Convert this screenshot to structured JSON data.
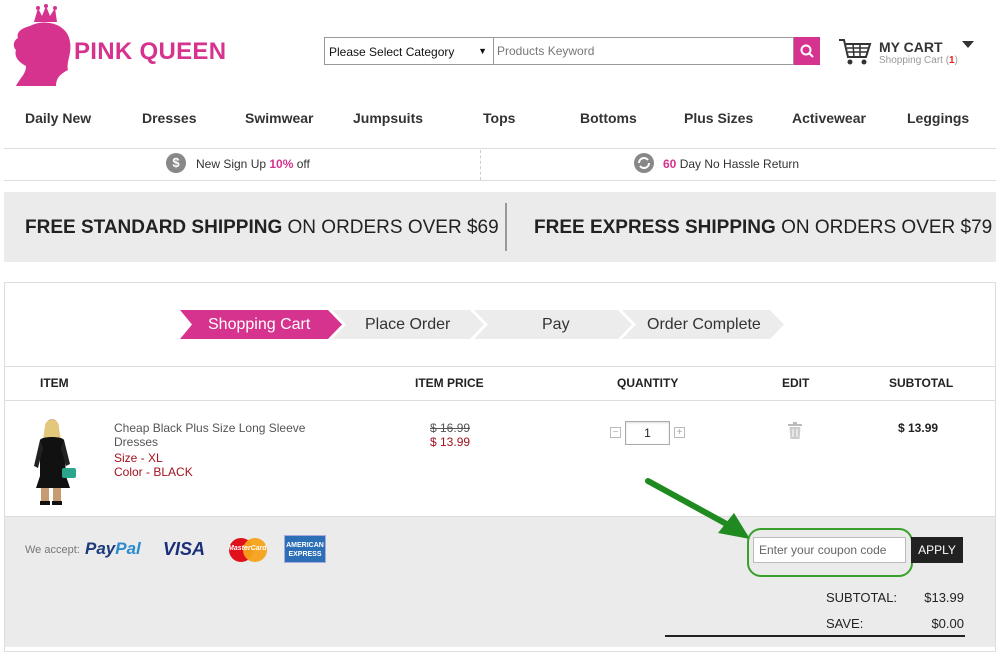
{
  "header": {
    "brand": "PINK QUEEN",
    "category_select": "Please Select Category",
    "search_placeholder": "Products Keyword",
    "cart_title": "MY CART",
    "cart_sub_prefix": "Shopping Cart (",
    "cart_count": "1",
    "cart_sub_suffix": ")"
  },
  "nav": [
    "Daily New",
    "Dresses",
    "Swimwear",
    "Jumpsuits",
    "Tops",
    "Bottoms",
    "Plus Sizes",
    "Activewear",
    "Leggings"
  ],
  "promo": {
    "left_icon": "$",
    "left_pre": "New Sign Up ",
    "left_hl": "10%",
    "left_post": " off",
    "right_hl": "60",
    "right_post": " Day No Hassle Return"
  },
  "shipping": {
    "left_bold": "FREE STANDARD SHIPPING",
    "left_rest": " ON ORDERS OVER $69",
    "right_bold": "FREE EXPRESS SHIPPING",
    "right_rest": " ON ORDERS OVER $79"
  },
  "steps": [
    "Shopping Cart",
    "Place Order",
    "Pay",
    "Order Complete"
  ],
  "columns": {
    "item": "ITEM",
    "price": "ITEM PRICE",
    "quantity": "QUANTITY",
    "edit": "EDIT",
    "subtotal": "SUBTOTAL"
  },
  "item": {
    "name": "Cheap Black Plus Size Long Sleeve Dresses",
    "size": "Size - XL",
    "color": "Color - BLACK",
    "price_old": "$ 16.99",
    "price_new": "$ 13.99",
    "qty": "1",
    "subtotal": "$ 13.99"
  },
  "footer": {
    "we_accept": "We accept:",
    "paypal_a": "Pay",
    "paypal_b": "Pal",
    "visa": "VISA",
    "mastercard": "MasterCard",
    "amex": "AMERICAN EXPRESS",
    "coupon_placeholder": "Enter your coupon code",
    "apply": "APPLY",
    "subtotal_label": "SUBTOTAL:",
    "subtotal_value": "$13.99",
    "save_label": "SAVE:",
    "save_value": "$0.00"
  },
  "colors": {
    "brand_pink": "#d6338f",
    "price_red": "#a3121e",
    "highlight_green": "#3aa02c"
  },
  "icons": [
    "crown-logo-icon",
    "search-icon",
    "cart-icon",
    "dollar-icon",
    "return-icon",
    "trash-icon",
    "annotation-arrow-icon"
  ]
}
